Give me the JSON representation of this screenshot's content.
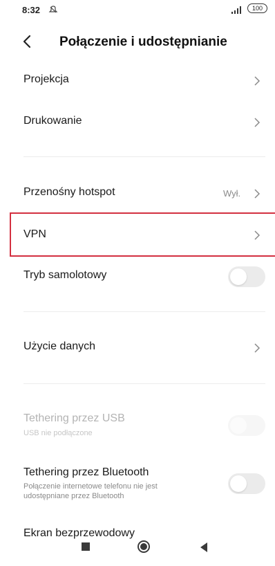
{
  "status_bar": {
    "time": "8:32",
    "battery": "100"
  },
  "header": {
    "title": "Połączenie i udostępnianie"
  },
  "items": {
    "projekcja": {
      "label": "Projekcja"
    },
    "drukowanie": {
      "label": "Drukowanie"
    },
    "hotspot": {
      "label": "Przenośny hotspot",
      "value": "Wył."
    },
    "vpn": {
      "label": "VPN"
    },
    "airplane": {
      "label": "Tryb samolotowy",
      "enabled": false
    },
    "data_usage": {
      "label": "Użycie danych"
    },
    "usb_tethering": {
      "label": "Tethering przez USB",
      "sublabel": "USB nie podłączone",
      "enabled": false
    },
    "bt_tethering": {
      "label": "Tethering przez Bluetooth",
      "sublabel_line1": "Połączenie internetowe telefonu nie jest",
      "sublabel_line2": "udostępniane przez Bluetooth",
      "enabled": false
    },
    "wireless_display": {
      "label": "Ekran bezprzewodowy"
    }
  },
  "colors": {
    "highlight": "#d32f3f",
    "toggle_off": "#ebebeb",
    "muted_text": "#b3b3b3"
  },
  "icons": {
    "back": "back-chevron-icon",
    "chevron": "chevron-right-icon",
    "alarm": "alarm-off-icon",
    "signal": "signal-icon",
    "battery": "battery-icon",
    "nav_recents": "recents-square-icon",
    "nav_home": "home-circle-icon",
    "nav_back": "back-triangle-icon"
  }
}
